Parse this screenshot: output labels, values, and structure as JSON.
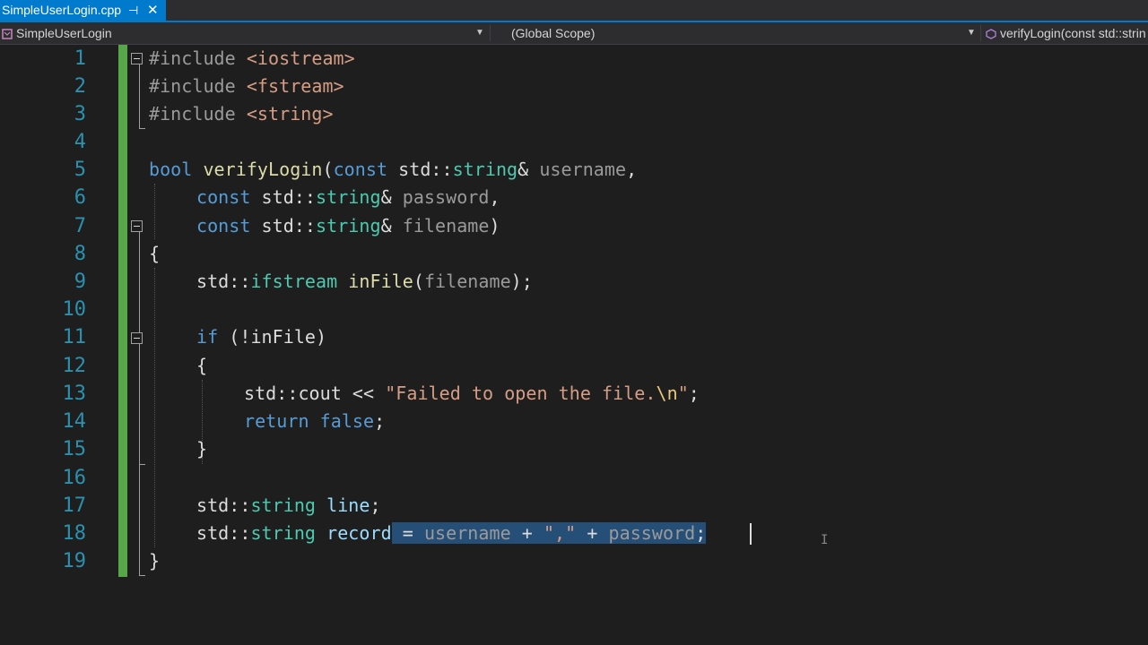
{
  "tab": {
    "filename": "SimpleUserLogin.cpp",
    "pin_icon": "pin-icon",
    "close_icon": "close-icon"
  },
  "navbar": {
    "project": "SimpleUserLogin",
    "scope": "(Global Scope)",
    "member": "verifyLogin(const std::strin"
  },
  "editor": {
    "line_numbers": [
      "1",
      "2",
      "3",
      "4",
      "5",
      "6",
      "7",
      "8",
      "9",
      "10",
      "11",
      "12",
      "13",
      "14",
      "15",
      "16",
      "17",
      "18",
      "19"
    ],
    "lines": {
      "l1": {
        "pp": "#include ",
        "inc": "<iostream>"
      },
      "l2": {
        "pp": "#include ",
        "inc": "<fstream>"
      },
      "l3": {
        "pp": "#include ",
        "inc": "<string>"
      },
      "l5": {
        "kw": "bool",
        "fn": "verifyLogin",
        "open": "(",
        "kw2": "const",
        "ns": " std::",
        "ty": "string",
        "amp": "& ",
        "prm": "username",
        "tail": ","
      },
      "l6": {
        "kw": "const",
        "ns": " std::",
        "ty": "string",
        "amp": "& ",
        "prm": "password",
        "tail": ","
      },
      "l7": {
        "kw": "const",
        "ns": " std::",
        "ty": "string",
        "amp": "& ",
        "prm": "filename",
        "tail": ")"
      },
      "l8": {
        "text": "{"
      },
      "l9": {
        "ns": "std::",
        "ty": "ifstream",
        "var": "inFile",
        "open": "(",
        "prm": "filename",
        "tail": ");"
      },
      "l11": {
        "kw": "if",
        "open": " (!",
        "var": "inFile",
        "tail": ")"
      },
      "l12": {
        "text": "{"
      },
      "l13": {
        "ns": "std::",
        "var": "cout",
        "op": " << ",
        "str": "\"Failed to open the file.",
        "esc": "\\n",
        "str2": "\"",
        "tail": ";"
      },
      "l14": {
        "kw": "return",
        "kw2": "false",
        "tail": ";"
      },
      "l15": {
        "text": "}"
      },
      "l17": {
        "ns": "std::",
        "ty": "string",
        "var": "line",
        "tail": ";"
      },
      "l18": {
        "ns": "std::",
        "ty": "string",
        "var": "record",
        "sel1": " = ",
        "selvar": "username",
        "sel2": " + ",
        "selstr": "\",\"",
        "sel3": " + ",
        "selvar2": "password",
        "sel4": ";"
      },
      "l19": {
        "text": "}"
      }
    }
  },
  "colors": {
    "accent": "#007acc",
    "changed_lines": "#57a64a",
    "selection": "#264f78"
  }
}
